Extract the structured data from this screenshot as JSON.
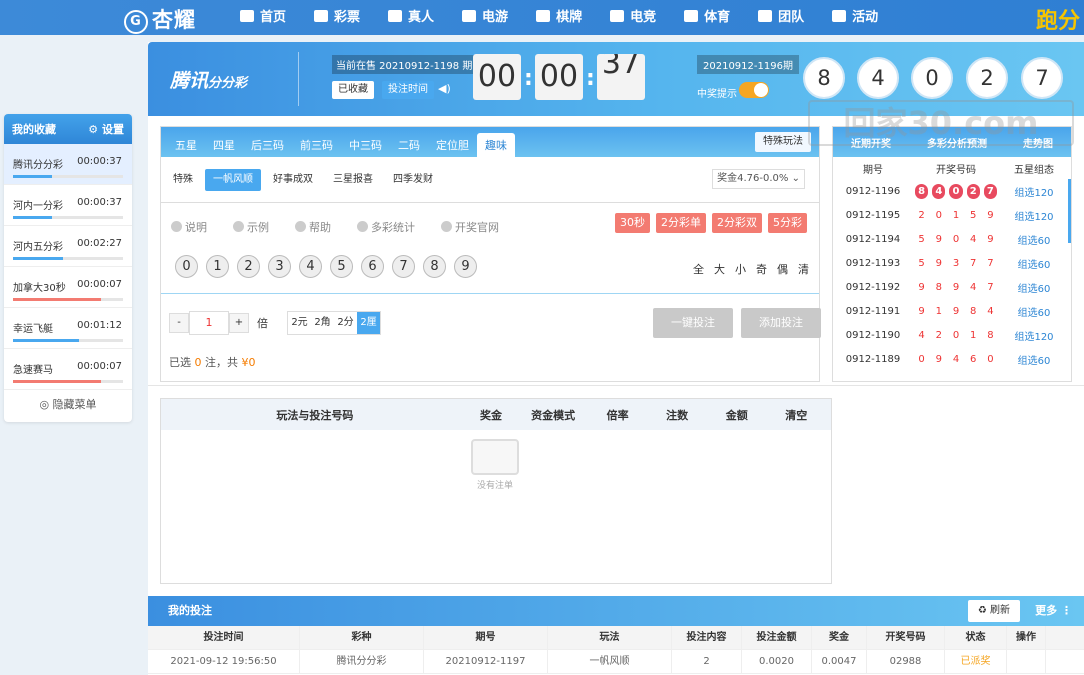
{
  "topnav": {
    "logo": "杏耀",
    "logo_mark": "G",
    "items": [
      "首页",
      "彩票",
      "真人",
      "电游",
      "棋牌",
      "电竞",
      "体育",
      "团队",
      "活动"
    ],
    "right": "跑分"
  },
  "sidebar": {
    "title": "我的收藏",
    "settings": "设置",
    "items": [
      {
        "name": "腾讯分分彩",
        "time": "00:00:37",
        "progress": 0.35,
        "active": true
      },
      {
        "name": "河内一分彩",
        "time": "00:00:37",
        "progress": 0.35
      },
      {
        "name": "河内五分彩",
        "time": "00:02:27",
        "progress": 0.45
      },
      {
        "name": "加拿大30秒",
        "time": "00:00:07",
        "progress": 0.8
      },
      {
        "name": "幸运飞艇",
        "time": "00:01:12",
        "progress": 0.6
      },
      {
        "name": "急速赛马",
        "time": "00:00:07",
        "progress": 0.8
      }
    ],
    "hide": "隐藏菜单"
  },
  "banner": {
    "brand": "腾讯",
    "brand2": "分分彩",
    "current": "当前在售 20210912-1198 期",
    "fav_btn": "已收藏",
    "time_btn": "投注时间",
    "t1": "00",
    "t2": "00",
    "t3": "37",
    "prev_period": "20210912-1196期",
    "prize_hint": "中奖提示",
    "balls": [
      "8",
      "4",
      "0",
      "2",
      "7"
    ]
  },
  "tabs": {
    "items": [
      "五星",
      "四星",
      "后三码",
      "前三码",
      "中三码",
      "二码",
      "定位胆",
      "趣味"
    ],
    "special": "特殊玩法"
  },
  "subtabs": {
    "items": [
      "特殊",
      "一帆风顺",
      "好事成双",
      "三星报喜",
      "四季发财"
    ],
    "odds": "奖金4.76-0.0%"
  },
  "links": [
    "说明",
    "示例",
    "帮助",
    "多彩统计",
    "开奖官网"
  ],
  "modes": [
    "30秒",
    "2分彩单",
    "2分彩双",
    "5分彩"
  ],
  "numbers": [
    "0",
    "1",
    "2",
    "3",
    "4",
    "5",
    "6",
    "7",
    "8",
    "9"
  ],
  "quick": [
    "全",
    "大",
    "小",
    "奇",
    "偶",
    "清"
  ],
  "multiplier": {
    "minus": "-",
    "value": "1",
    "plus": "+",
    "label": "倍"
  },
  "units": [
    "2元",
    "2角",
    "2分",
    "2厘"
  ],
  "buttons": {
    "one": "一键投注",
    "add": "添加投注"
  },
  "selected": {
    "pre": "已选",
    "count": "0",
    "mid": "注，共",
    "amount": "¥0"
  },
  "history": {
    "tabs": [
      "近期开奖",
      "多彩分析预测",
      "走势图"
    ],
    "headers": [
      "期号",
      "开奖号码",
      "五星组态"
    ],
    "rows": [
      {
        "p": "0912-1196",
        "n": [
          "8",
          "4",
          "0",
          "2",
          "7"
        ],
        "s": "组选120"
      },
      {
        "p": "0912-1195",
        "n": [
          "2",
          "0",
          "1",
          "5",
          "9"
        ],
        "s": "组选120"
      },
      {
        "p": "0912-1194",
        "n": [
          "5",
          "9",
          "0",
          "4",
          "9"
        ],
        "s": "组选60"
      },
      {
        "p": "0912-1193",
        "n": [
          "5",
          "9",
          "3",
          "7",
          "7"
        ],
        "s": "组选60"
      },
      {
        "p": "0912-1192",
        "n": [
          "9",
          "8",
          "9",
          "4",
          "7"
        ],
        "s": "组选60"
      },
      {
        "p": "0912-1191",
        "n": [
          "9",
          "1",
          "9",
          "8",
          "4"
        ],
        "s": "组选60"
      },
      {
        "p": "0912-1190",
        "n": [
          "4",
          "2",
          "0",
          "1",
          "8"
        ],
        "s": "组选120"
      },
      {
        "p": "0912-1189",
        "n": [
          "0",
          "9",
          "4",
          "6",
          "0"
        ],
        "s": "组选60"
      }
    ]
  },
  "cart": {
    "headers": [
      "玩法与投注号码",
      "奖金",
      "资金模式",
      "倍率",
      "注数",
      "金额",
      "清空"
    ],
    "empty": "没有注单"
  },
  "mybets": {
    "title": "我的投注",
    "refresh": "刷新",
    "more": "更多",
    "headers": [
      "投注时间",
      "彩种",
      "期号",
      "玩法",
      "投注内容",
      "投注金额",
      "奖金",
      "开奖号码",
      "状态",
      "操作"
    ],
    "row": [
      "2021-09-12 19:56:50",
      "腾讯分分彩",
      "20210912-1197",
      "一帆风顺",
      "2",
      "0.0020",
      "0.0047",
      "02988",
      "已派奖",
      ""
    ]
  },
  "watermark": "回家30.com"
}
